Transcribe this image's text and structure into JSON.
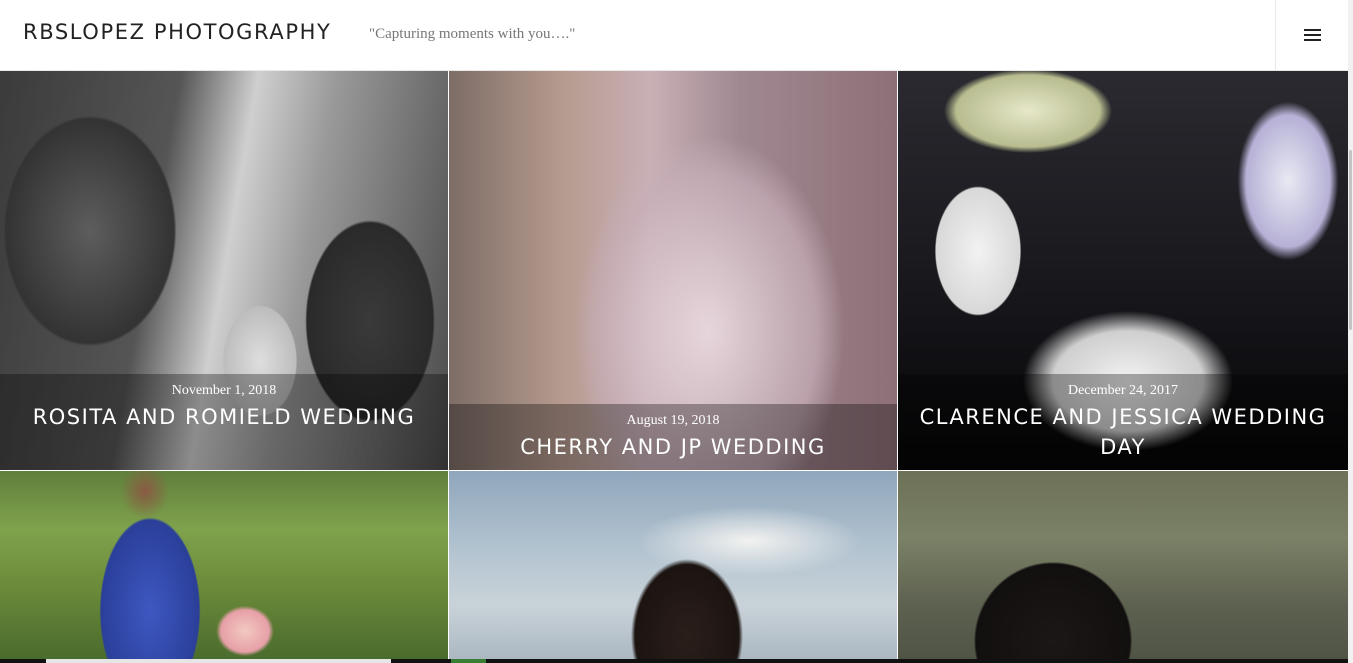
{
  "header": {
    "site_title": "RBSLOPEZ PHOTOGRAPHY",
    "tagline": "\"Capturing moments with you….\"",
    "menu_icon": "hamburger-menu-icon"
  },
  "posts": [
    {
      "date": "November 1, 2018",
      "title": "ROSITA AND ROMIELD WEDDING"
    },
    {
      "date": "August 19, 2018",
      "title": "CHERRY AND JP WEDDING"
    },
    {
      "date": "December 24, 2017",
      "title": "CLARENCE AND JESSICA WEDDING DAY"
    },
    {
      "date": "",
      "title": ""
    },
    {
      "date": "",
      "title": ""
    },
    {
      "date": "",
      "title": ""
    }
  ]
}
